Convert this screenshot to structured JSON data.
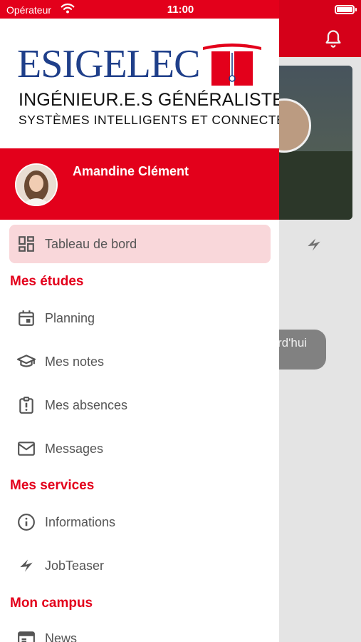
{
  "status_bar": {
    "carrier": "Opérateur",
    "time": "11:00"
  },
  "logo": {
    "wordmark": "ESIGELEC",
    "tagline1": "INGÉNIEUR.E.S GÉNÉRALISTES",
    "tagline2": "SYSTÈMES INTELLIGENTS ET CONNECTÉS"
  },
  "profile": {
    "name": "Amandine Clément"
  },
  "menu": {
    "dashboard": {
      "label": "Tableau de bord",
      "icon": "dashboard-icon"
    },
    "sections": [
      {
        "title": "Mes études",
        "items": [
          {
            "label": "Planning",
            "icon": "calendar-icon"
          },
          {
            "label": "Mes notes",
            "icon": "graduation-cap-icon"
          },
          {
            "label": "Mes absences",
            "icon": "clipboard-alert-icon"
          },
          {
            "label": "Messages",
            "icon": "envelope-icon"
          }
        ]
      },
      {
        "title": "Mes services",
        "items": [
          {
            "label": "Informations",
            "icon": "info-icon"
          },
          {
            "label": "JobTeaser",
            "icon": "jobteaser-icon"
          }
        ]
      },
      {
        "title": "Mon campus",
        "items": [
          {
            "label": "News",
            "icon": "news-icon"
          }
        ]
      }
    ]
  },
  "background": {
    "pill_text": "rd'hui"
  },
  "colors": {
    "accent": "#e3001b",
    "active_bg": "#f9d7da",
    "brand_blue": "#1f3f8a"
  }
}
